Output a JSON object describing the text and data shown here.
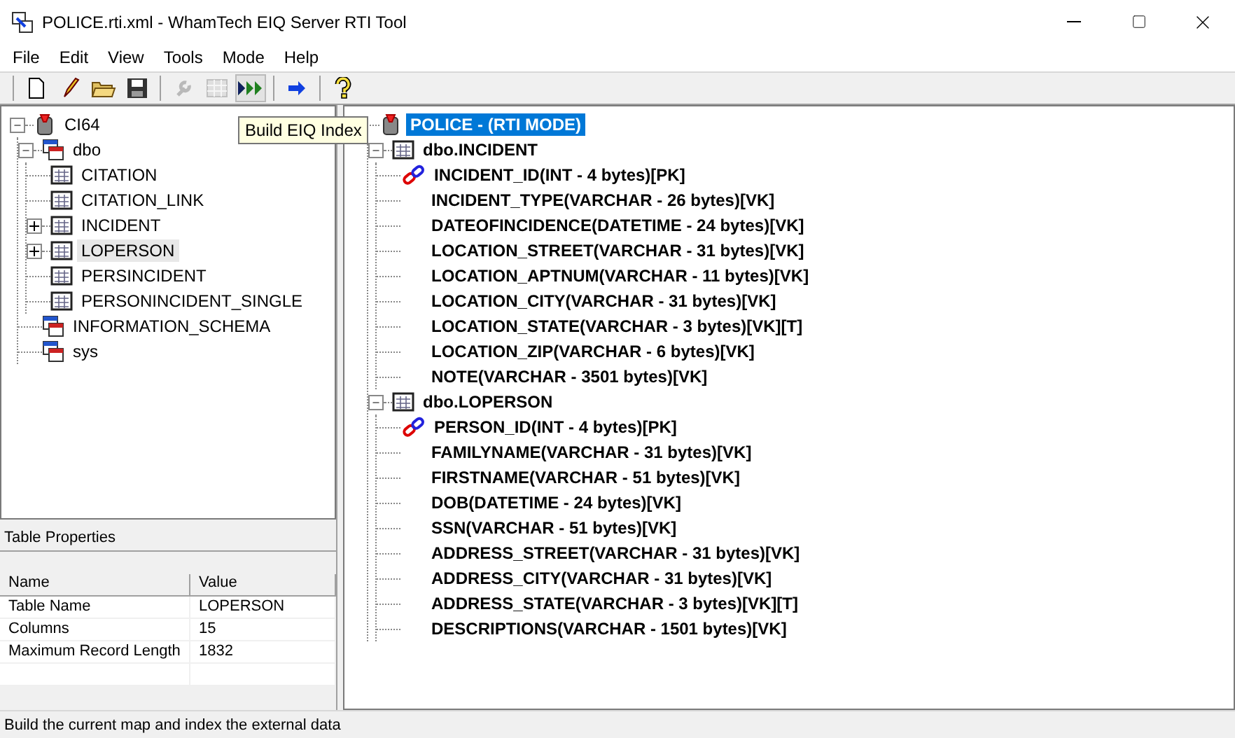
{
  "window": {
    "title": "POLICE.rti.xml - WhamTech EIQ Server RTI Tool"
  },
  "menu": [
    "File",
    "Edit",
    "View",
    "Tools",
    "Mode",
    "Help"
  ],
  "toolbar": [
    {
      "kind": "new",
      "disabled": false
    },
    {
      "kind": "edit",
      "disabled": false
    },
    {
      "kind": "open",
      "disabled": false
    },
    {
      "kind": "save",
      "disabled": false
    },
    {
      "kind": "separator"
    },
    {
      "kind": "wrench",
      "disabled": true
    },
    {
      "kind": "grid",
      "disabled": true
    },
    {
      "kind": "build",
      "disabled": false,
      "pressed": true
    },
    {
      "kind": "separator"
    },
    {
      "kind": "arrow",
      "disabled": false
    },
    {
      "kind": "separator"
    },
    {
      "kind": "help",
      "disabled": false
    }
  ],
  "tooltip": "Build EIQ Index",
  "left_tree": [
    {
      "label": "CI64",
      "kind": "database",
      "selected": false,
      "expanded": true,
      "children": [
        {
          "label": "dbo",
          "kind": "schema",
          "selected": false,
          "expanded": true,
          "children": [
            {
              "label": "CITATION",
              "kind": "table",
              "selected": false
            },
            {
              "label": "CITATION_LINK",
              "kind": "table",
              "selected": false
            },
            {
              "label": "INCIDENT",
              "kind": "table",
              "selected": false,
              "expanded": false
            },
            {
              "label": "LOPERSON",
              "kind": "table",
              "selected": true,
              "expanded": false
            },
            {
              "label": "PERSINCIDENT",
              "kind": "table",
              "selected": false
            },
            {
              "label": "PERSONINCIDENT_SINGLE",
              "kind": "table",
              "selected": false
            }
          ]
        },
        {
          "label": "INFORMATION_SCHEMA",
          "kind": "schema",
          "selected": false
        },
        {
          "label": "sys",
          "kind": "schema",
          "selected": false
        }
      ]
    }
  ],
  "properties": {
    "title": "Table Properties",
    "columns": [
      "Name",
      "Value"
    ],
    "rows": [
      [
        "Table Name",
        "LOPERSON"
      ],
      [
        "Columns",
        "15"
      ],
      [
        "Maximum Record Length",
        "1832"
      ]
    ]
  },
  "right_tree": [
    {
      "label": "POLICE  - (RTI MODE)",
      "kind": "database",
      "selected": true,
      "children": [
        {
          "label": "dbo.INCIDENT",
          "kind": "table",
          "selected": false,
          "expanded": true,
          "children": [
            {
              "label": "INCIDENT_ID(INT - 4 bytes)[PK]",
              "kind": "key",
              "selected": false
            },
            {
              "label": "INCIDENT_TYPE(VARCHAR - 26 bytes)[VK]",
              "kind": "field",
              "selected": false
            },
            {
              "label": "DATEOFINCIDENCE(DATETIME - 24 bytes)[VK]",
              "kind": "field",
              "selected": false
            },
            {
              "label": "LOCATION_STREET(VARCHAR - 31 bytes)[VK]",
              "kind": "field",
              "selected": false
            },
            {
              "label": "LOCATION_APTNUM(VARCHAR - 11 bytes)[VK]",
              "kind": "field",
              "selected": false
            },
            {
              "label": "LOCATION_CITY(VARCHAR - 31 bytes)[VK]",
              "kind": "field",
              "selected": false
            },
            {
              "label": "LOCATION_STATE(VARCHAR - 3 bytes)[VK][T]",
              "kind": "field",
              "selected": false
            },
            {
              "label": "LOCATION_ZIP(VARCHAR - 6 bytes)[VK]",
              "kind": "field",
              "selected": false
            },
            {
              "label": "NOTE(VARCHAR - 3501 bytes)[VK]",
              "kind": "field",
              "selected": false
            }
          ]
        },
        {
          "label": "dbo.LOPERSON",
          "kind": "table",
          "selected": false,
          "expanded": true,
          "children": [
            {
              "label": "PERSON_ID(INT - 4 bytes)[PK]",
              "kind": "key",
              "selected": false
            },
            {
              "label": "FAMILYNAME(VARCHAR - 31 bytes)[VK]",
              "kind": "field",
              "selected": false
            },
            {
              "label": "FIRSTNAME(VARCHAR - 51 bytes)[VK]",
              "kind": "field",
              "selected": false
            },
            {
              "label": "DOB(DATETIME - 24 bytes)[VK]",
              "kind": "field",
              "selected": false
            },
            {
              "label": "SSN(VARCHAR - 51 bytes)[VK]",
              "kind": "field",
              "selected": false
            },
            {
              "label": "ADDRESS_STREET(VARCHAR - 31 bytes)[VK]",
              "kind": "field",
              "selected": false
            },
            {
              "label": "ADDRESS_CITY(VARCHAR - 31 bytes)[VK]",
              "kind": "field",
              "selected": false
            },
            {
              "label": "ADDRESS_STATE(VARCHAR - 3 bytes)[VK][T]",
              "kind": "field",
              "selected": false
            },
            {
              "label": "DESCRIPTIONS(VARCHAR - 1501 bytes)[VK]",
              "kind": "field",
              "selected": false
            }
          ]
        }
      ]
    }
  ],
  "status_bar": "Build the current map and index the external data"
}
